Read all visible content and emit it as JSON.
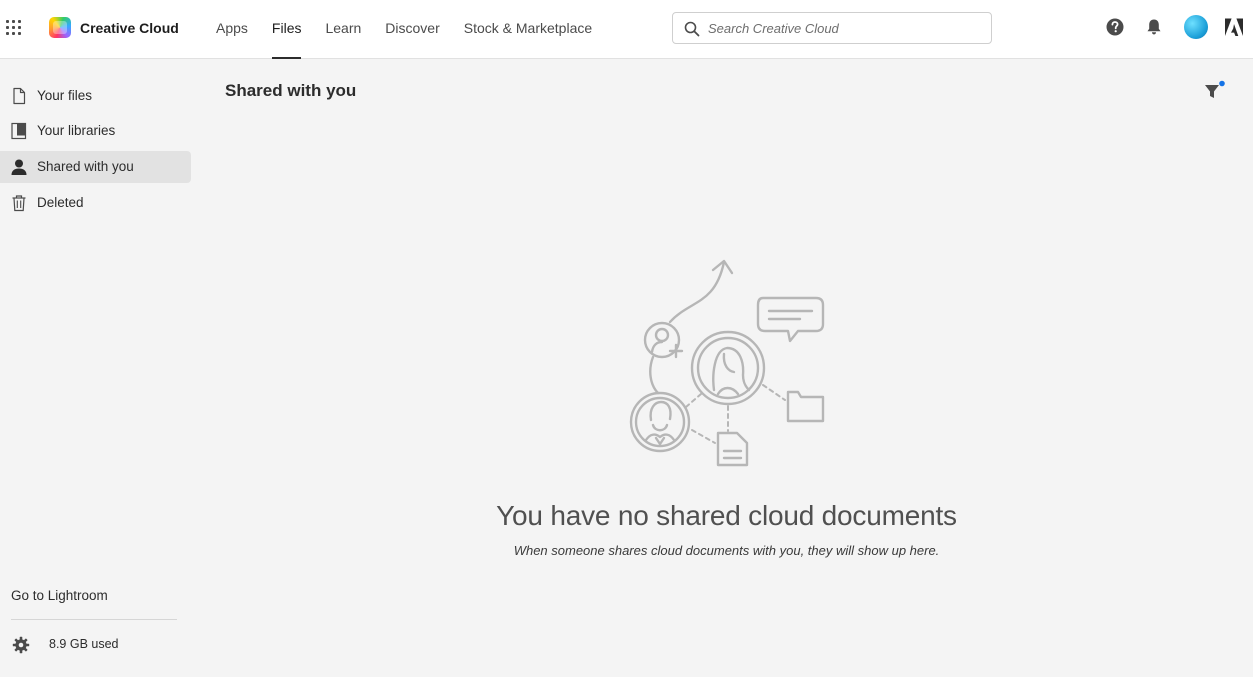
{
  "app": {
    "name": "Creative Cloud",
    "brand_color": "#e8375a"
  },
  "header": {
    "nav": [
      {
        "label": "Apps",
        "active": false
      },
      {
        "label": "Files",
        "active": true
      },
      {
        "label": "Learn",
        "active": false
      },
      {
        "label": "Discover",
        "active": false
      },
      {
        "label": "Stock & Marketplace",
        "active": false
      }
    ],
    "search": {
      "placeholder": "Search Creative Cloud",
      "value": ""
    },
    "icons": [
      "app-switcher-icon",
      "search-icon",
      "help-icon",
      "bell-icon",
      "avatar",
      "adobe-logo-icon"
    ]
  },
  "sidebar": {
    "items": [
      {
        "label": "Your files",
        "icon": "file-icon",
        "active": false
      },
      {
        "label": "Your libraries",
        "icon": "library-icon",
        "active": false
      },
      {
        "label": "Shared with you",
        "icon": "user-icon",
        "active": true
      },
      {
        "label": "Deleted",
        "icon": "trash-icon",
        "active": false
      }
    ],
    "footer": {
      "lightroom_link": "Go to Lightroom",
      "storage_text": "8.9 GB used"
    }
  },
  "main": {
    "title": "Shared with you",
    "filter_badge_color": "#1473e6",
    "empty_state": {
      "title": "You have no shared cloud documents",
      "subtitle": "When someone shares cloud documents with you, they will show up here."
    }
  }
}
